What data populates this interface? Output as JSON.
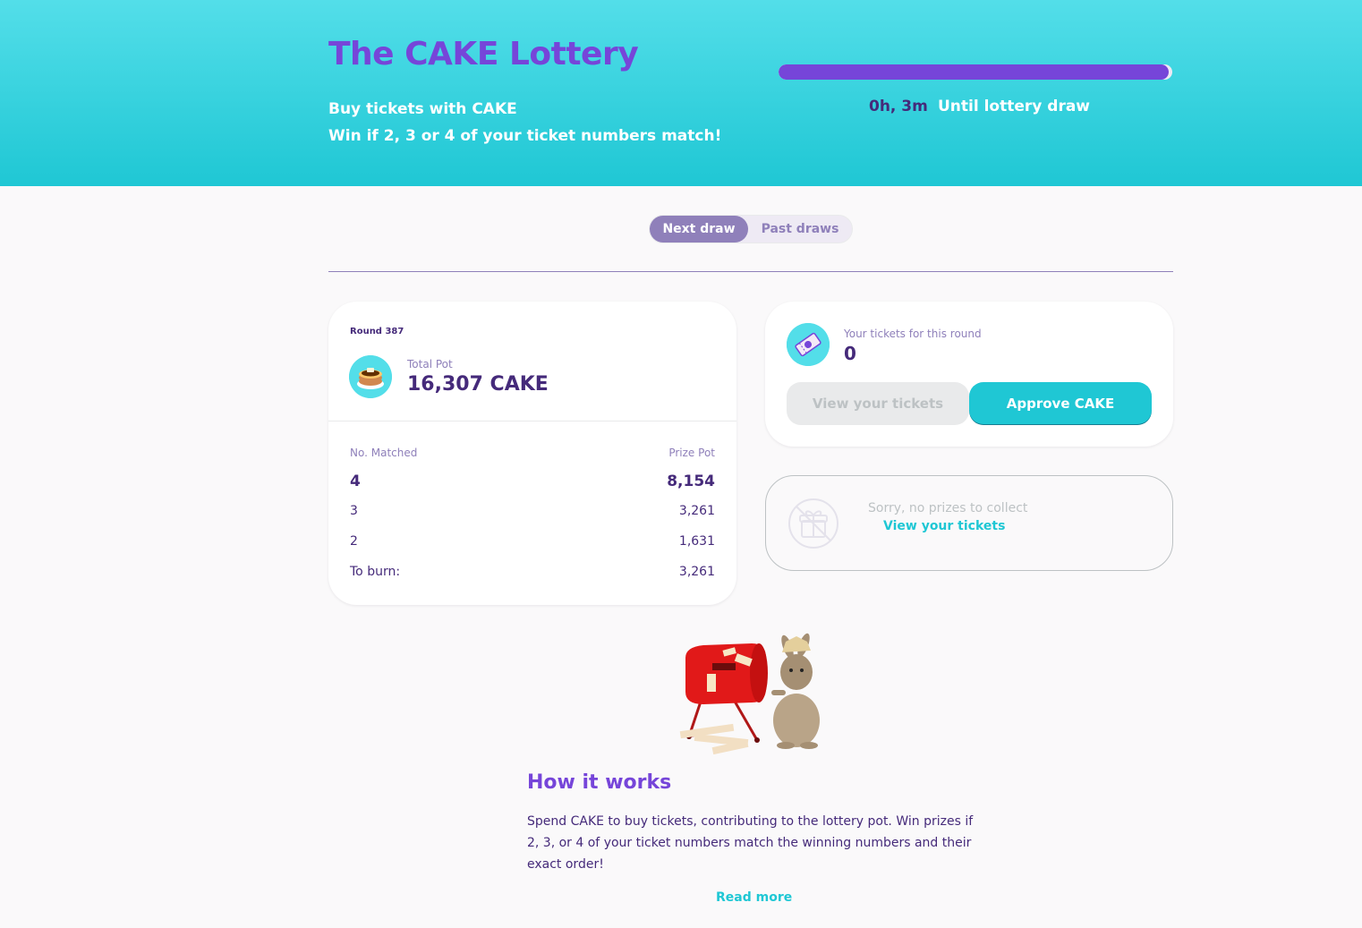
{
  "hero": {
    "title": "The CAKE Lottery",
    "subtitle_1": "Buy tickets with CAKE",
    "subtitle_2": "Win if 2, 3 or 4 of your ticket numbers match!",
    "countdown": "0h, 3m",
    "countdown_label": "Until lottery draw",
    "progress_fraction": 0.99
  },
  "tabs": [
    {
      "label": "Next draw",
      "active": true
    },
    {
      "label": "Past draws",
      "active": false
    }
  ],
  "pot_card": {
    "round": "Round 387",
    "total_pot_caption": "Total Pot",
    "total_pot_value": "16,307 CAKE",
    "col_matched": "No. Matched",
    "col_prize": "Prize Pot",
    "rows": [
      {
        "matched": "4",
        "prize": "8,154"
      },
      {
        "matched": "3",
        "prize": "3,261"
      },
      {
        "matched": "2",
        "prize": "1,631"
      },
      {
        "matched": "To burn:",
        "prize": "3,261"
      }
    ]
  },
  "tickets_card": {
    "caption": "Your tickets for this round",
    "count": "0",
    "view_button": "View your tickets",
    "approve_button": "Approve CAKE"
  },
  "prize_card": {
    "message": "Sorry, no prizes to collect",
    "link": "View your tickets"
  },
  "how_it_works": {
    "title": "How it works",
    "text": "Spend CAKE to buy tickets, contributing to the lottery pot. Win prizes if 2, 3, or 4 of your ticket numbers match the winning numbers and their exact order!",
    "read_more": "Read more"
  },
  "colors": {
    "primary": "#1fc7d4",
    "secondary": "#7645d9",
    "text": "#452a7a",
    "text_subtle": "#8f80ba"
  }
}
